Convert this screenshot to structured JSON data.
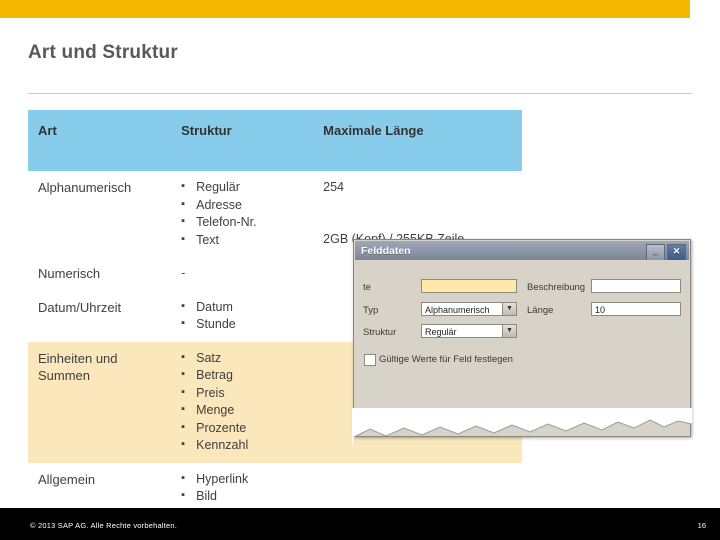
{
  "slide": {
    "title": "Art und Struktur",
    "accent_yellow": "#f5b800",
    "header_blue": "#87cdeb",
    "row_cream": "#fbe7bc"
  },
  "table": {
    "headers": [
      "Art",
      "Struktur",
      "Maximale Länge"
    ],
    "rows": [
      {
        "art": "Alphanumerisch",
        "struktur": [
          "Regulär",
          "Adresse",
          "Telefon-Nr.",
          "Text"
        ],
        "laenge_lines": [
          "254",
          "",
          "",
          "2GB (Kopf) / 255KB Zeile"
        ],
        "shade": "white"
      },
      {
        "art": "Numerisch",
        "struktur_plain": "-",
        "laenge_lines": [
          ""
        ],
        "shade": "white"
      },
      {
        "art": "Datum/Uhrzeit",
        "struktur": [
          "Datum",
          "Stunde"
        ],
        "laenge_lines": [
          ""
        ],
        "shade": "white"
      },
      {
        "art": "Einheiten und Summen",
        "struktur": [
          "Satz",
          "Betrag",
          "Preis",
          "Menge",
          "Prozente",
          "Kennzahl"
        ],
        "laenge_lines": [
          ""
        ],
        "shade": "cream"
      },
      {
        "art": "Allgemein",
        "struktur": [
          "Hyperlink",
          "Bild"
        ],
        "laenge_lines": [
          ""
        ],
        "shade": "white"
      }
    ]
  },
  "dialog": {
    "title": "Felddaten",
    "buttons": {
      "minimize": "_",
      "close": "✕"
    },
    "fields": {
      "name_label": "te",
      "name_value": "",
      "beschreibung_label": "Beschreibung",
      "beschreibung_value": "",
      "typ_label": "Typ",
      "typ_value": "Alphanumerisch",
      "laenge_label": "Länge",
      "laenge_value": "10",
      "struktur_label": "Struktur",
      "struktur_value": "Regulär",
      "checkbox_label": "Gültige Werte für Feld festlegen",
      "checkbox_checked": false
    }
  },
  "footer": {
    "copyright": "© 2013 SAP AG. Alle Rechte vorbehalten.",
    "page": "16"
  }
}
